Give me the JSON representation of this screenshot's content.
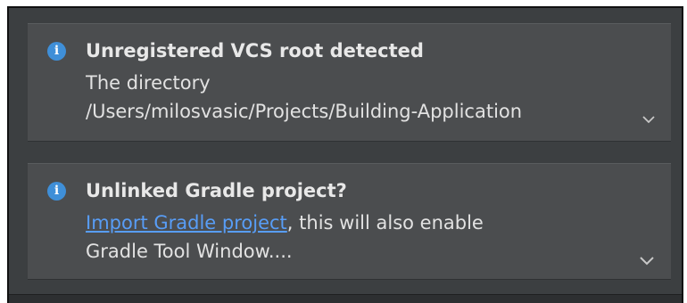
{
  "notifications": [
    {
      "icon": "info-icon",
      "title": "Unregistered VCS root detected",
      "body_line1": "The directory",
      "body_line2": "/Users/milosvasic/Projects/Building-Application",
      "expand_icon": "chevron-down-icon"
    },
    {
      "icon": "info-icon",
      "title": "Unlinked Gradle project?",
      "link_text": "Import Gradle project",
      "body_rest": ", this will also enable",
      "body_line2": "Gradle Tool Window....",
      "expand_icon": "chevron-down-icon"
    }
  ],
  "colors": {
    "panel_bg": "#3c3f41",
    "notification_bg": "#4b4d4f",
    "info_icon": "#3f8fd8",
    "link": "#589df6",
    "text": "#e6e6e6"
  }
}
